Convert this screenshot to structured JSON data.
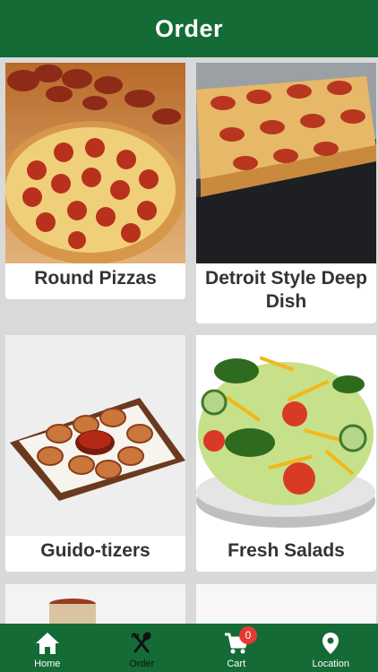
{
  "header": {
    "title": "Order"
  },
  "categories": [
    {
      "label": "Round Pizzas"
    },
    {
      "label": "Detroit Style Deep Dish"
    },
    {
      "label": "Guido-tizers"
    },
    {
      "label": "Fresh Salads"
    }
  ],
  "nav": {
    "items": [
      {
        "label": "Home",
        "icon": "home-icon"
      },
      {
        "label": "Order",
        "icon": "utensils-icon"
      },
      {
        "label": "Cart",
        "icon": "cart-icon",
        "badge": "0"
      },
      {
        "label": "Location",
        "icon": "location-pin-icon"
      }
    ]
  },
  "colors": {
    "brand": "#146b36",
    "background": "#d9d9d9",
    "badge": "#e53935",
    "label": "#333333"
  }
}
